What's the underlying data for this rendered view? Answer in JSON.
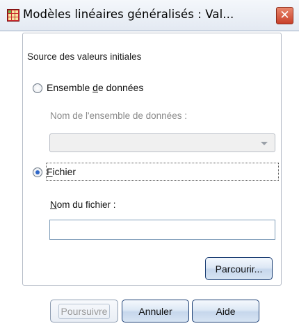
{
  "window": {
    "title": "Modèles linéaires généralisés : Val...",
    "icon": "spreadsheet-grid-icon",
    "close_glyph": "✕"
  },
  "group": {
    "legend": "Source des valeurs initiales"
  },
  "radio_dataset": {
    "label_before": "Ensemble ",
    "accel": "d",
    "label_after": "e données",
    "checked": false
  },
  "dataset_name": {
    "label": "Nom de l'ensemble de données :",
    "enabled": false,
    "selected_value": ""
  },
  "radio_file": {
    "accel": "F",
    "label_after": "ichier",
    "checked": true
  },
  "file_name": {
    "label_accel": "N",
    "label_after": "om du fichier :",
    "value": ""
  },
  "buttons": {
    "browse": "Parcourir...",
    "continue": "Poursuivre",
    "cancel": "Annuler",
    "help": "Aide"
  },
  "colors": {
    "accent": "#2f67c8",
    "button_border": "#1c3f74",
    "close_button": "#c9402a"
  }
}
